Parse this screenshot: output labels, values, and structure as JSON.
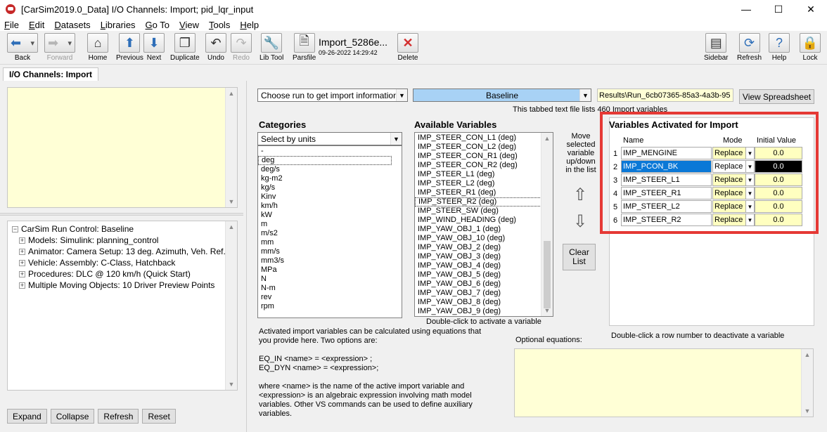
{
  "window": {
    "title": "[CarSim2019.0_Data] I/O Channels: Import; pid_lqr_input",
    "minimize": "—",
    "maximize": "☐",
    "close": "✕"
  },
  "menu": [
    "File",
    "Edit",
    "Datasets",
    "Libraries",
    "Go To",
    "View",
    "Tools",
    "Help"
  ],
  "toolbar": {
    "back": "Back",
    "forward": "Forward",
    "home": "Home",
    "previous": "Previous",
    "next": "Next",
    "duplicate": "Duplicate",
    "undo": "Undo",
    "redo": "Redo",
    "lib_tool": "Lib Tool",
    "parsfile": "Parsfile",
    "dataset_name": "Import_5286e...",
    "dataset_date": "09-26-2022 14:29:42",
    "delete": "Delete",
    "sidebar": "Sidebar",
    "refresh": "Refresh",
    "help": "Help",
    "lock": "Lock"
  },
  "tab": {
    "label": "I/O Channels: Import"
  },
  "left": {
    "tree": [
      "CarSim Run Control: Baseline",
      "Models: Simulink: planning_control",
      "Animator: Camera Setup: 13 deg. Azimuth, Veh. Ref.",
      "Vehicle: Assembly: C-Class, Hatchback",
      "Procedures: DLC @ 120 km/h (Quick Start)",
      "Multiple Moving Objects: 10 Driver Preview Points"
    ],
    "buttons": {
      "expand": "Expand",
      "collapse": "Collapse",
      "refresh": "Refresh",
      "reset": "Reset"
    }
  },
  "right": {
    "run_select": "Choose run to get import information",
    "run_combo": "Baseline",
    "results_path": "Results\\Run_6cb07365-85a3-4a3b-95",
    "view_spreadsheet": "View Spreadsheet",
    "tabbed_info": "This tabbed text file lists 460 Import variables",
    "categories_title": "Categories",
    "categories_combo": "Select by units",
    "categories": [
      "-",
      "deg",
      "deg/s",
      "kg-m2",
      "kg/s",
      "Kinv",
      "km/h",
      "kW",
      "m",
      "m/s2",
      "mm",
      "mm/s",
      "mm3/s",
      "MPa",
      "N",
      "N-m",
      "rev",
      "rpm"
    ],
    "available_title": "Available Variables",
    "available": [
      "IMP_STEER_CON_L1 (deg)",
      "IMP_STEER_CON_L2 (deg)",
      "IMP_STEER_CON_R1 (deg)",
      "IMP_STEER_CON_R2 (deg)",
      "IMP_STEER_L1 (deg)",
      "IMP_STEER_L2 (deg)",
      "IMP_STEER_R1 (deg)",
      "IMP_STEER_R2 (deg)",
      "IMP_STEER_SW (deg)",
      "IMP_WIND_HEADING (deg)",
      "IMP_YAW_OBJ_1 (deg)",
      "IMP_YAW_OBJ_10 (deg)",
      "IMP_YAW_OBJ_2 (deg)",
      "IMP_YAW_OBJ_3 (deg)",
      "IMP_YAW_OBJ_4 (deg)",
      "IMP_YAW_OBJ_5 (deg)",
      "IMP_YAW_OBJ_6 (deg)",
      "IMP_YAW_OBJ_7 (deg)",
      "IMP_YAW_OBJ_8 (deg)",
      "IMP_YAW_OBJ_9 (deg)"
    ],
    "double_click_activate": "Double-click to activate a variable",
    "move_text": [
      "Move",
      "selected",
      "variable",
      "up/down",
      "in the list"
    ],
    "clear_list": [
      "Clear",
      "List"
    ],
    "activated_title": "Variables Activated for Import",
    "grid_headers": {
      "name": "Name",
      "mode": "Mode",
      "initial": "Initial Value"
    },
    "activated": [
      {
        "num": "1",
        "name": "IMP_MENGINE",
        "mode": "Replace",
        "init": "0.0"
      },
      {
        "num": "2",
        "name": "IMP_PCON_BK",
        "mode": "Replace",
        "init": "0.0"
      },
      {
        "num": "3",
        "name": "IMP_STEER_L1",
        "mode": "Replace",
        "init": "0.0"
      },
      {
        "num": "4",
        "name": "IMP_STEER_R1",
        "mode": "Replace",
        "init": "0.0"
      },
      {
        "num": "5",
        "name": "IMP_STEER_L2",
        "mode": "Replace",
        "init": "0.0"
      },
      {
        "num": "6",
        "name": "IMP_STEER_R2",
        "mode": "Replace",
        "init": "0.0"
      }
    ],
    "double_click_deactivate": "Double-click a row number to deactivate a variable",
    "optional_equations": "Optional equations:",
    "info_lines": [
      "Activated import variables can be calculated using equations that",
      "you provide here. Two options are:",
      "",
      "EQ_IN <name> = <expression> ;",
      "EQ_DYN <name> = <expression>;",
      "",
      "where <name> is the name of the active import variable and",
      "<expression> is an algebraic expression involving math model",
      "variables. Other VS commands can be used to define auxiliary",
      "variables."
    ]
  },
  "colors": {
    "highlight": "#0a78d7",
    "note_yellow": "#ffffd6",
    "cell_yellow": "#ffffc0",
    "red_outline": "#e53935"
  }
}
